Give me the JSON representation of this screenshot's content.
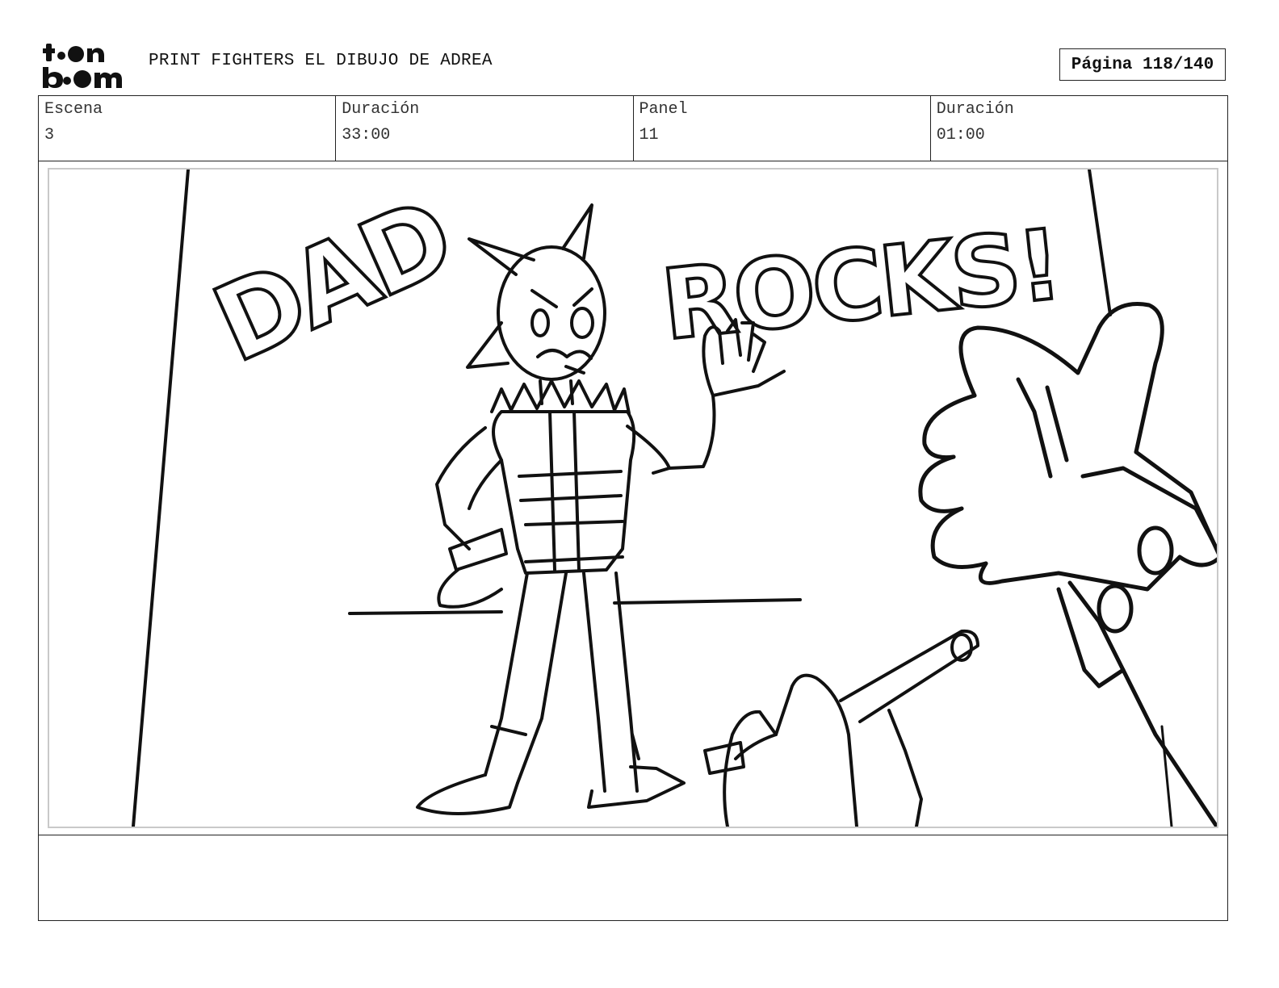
{
  "header": {
    "logo": {
      "line1": "toon",
      "line2": "boom",
      "icon": "toon-boom-logo"
    },
    "project_title": "PRINT FIGHTERS EL DIBUJO DE ADREA",
    "page_label": "Página 118/140"
  },
  "info": {
    "scene_label": "Escena",
    "scene_value": "3",
    "scene_duration_label": "Duración",
    "scene_duration_value": "33:00",
    "panel_label": "Panel",
    "panel_value": "11",
    "panel_duration_label": "Duración",
    "panel_duration_value": "01:00"
  },
  "panel_drawing": {
    "sketch_text_1": "DAD",
    "sketch_text_2": "ROCKS!"
  },
  "notes": {
    "text": ""
  }
}
